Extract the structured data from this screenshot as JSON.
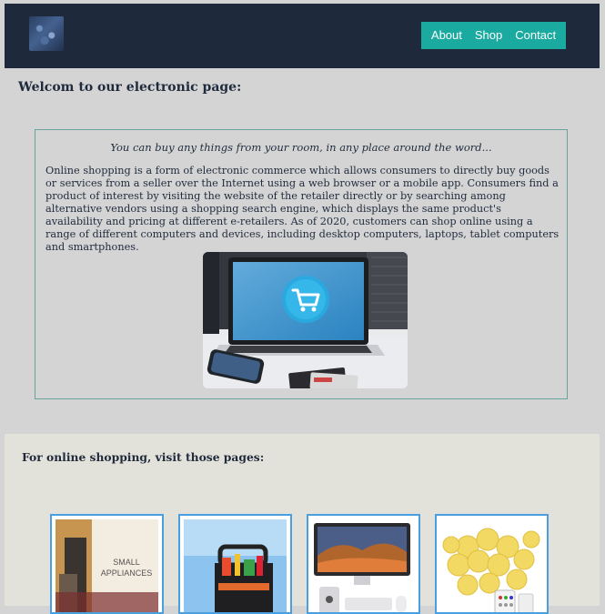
{
  "header": {
    "nav": [
      {
        "label": "About"
      },
      {
        "label": "Shop"
      },
      {
        "label": "Contact"
      }
    ]
  },
  "welcome_title": "Welcom to our electronic page:",
  "intro": {
    "tagline": "You can buy any things from your room, in any place around the word...",
    "description": "Online shopping is a form of electronic commerce which allows consumers to directly buy goods or services from a seller over the Internet using a web browser or a mobile app. Consumers find a product of interest by visiting the website of the retailer directly or by searching among alternative vendors using a shopping search engine, which displays the same product's availability and pricing at different e-retailers. As of 2020, customers can shop online using a range of different computers and devices, including desktop computers, laptops, tablet computers and smartphones."
  },
  "shop": {
    "title": "For online shopping, visit those pages:",
    "thumbs": [
      {
        "caption": "SMALL APPLIANCES"
      },
      {
        "caption": ""
      },
      {
        "caption": ""
      },
      {
        "caption": ""
      }
    ]
  }
}
